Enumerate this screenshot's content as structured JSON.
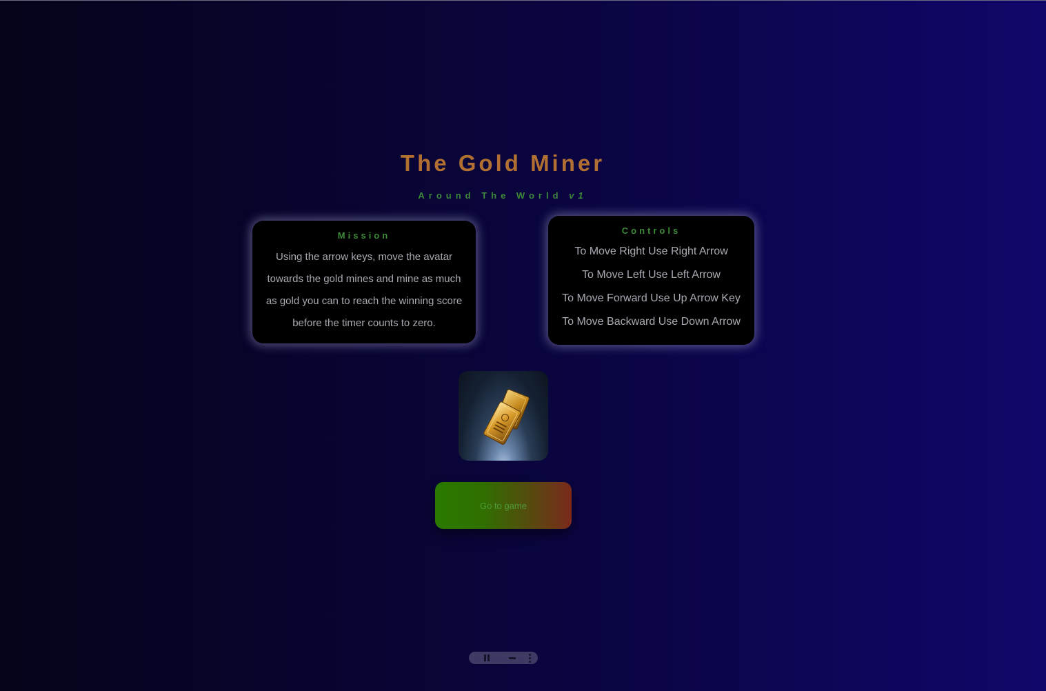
{
  "header": {
    "title": "The Gold Miner",
    "subtitle": "Around The World",
    "version": "v1"
  },
  "mission": {
    "heading": "Mission",
    "text": "Using the arrow keys, move the avatar towards the gold mines and mine as much as gold you can to reach the winning score before the timer counts to zero."
  },
  "controls": {
    "heading": "Controls",
    "items": [
      "To Move Right Use Right Arrow",
      "To Move Left Use Left Arrow",
      "To Move Forward Use Up Arrow Key",
      "To Move Backward Use Down Arrow"
    ]
  },
  "image": {
    "icon": "gold-bars-image"
  },
  "button": {
    "label": "Go to game"
  },
  "media_bar": {
    "icons": [
      "pause-icon",
      "slider-icon",
      "more-options-icon"
    ]
  },
  "colors": {
    "title": "#b26f32",
    "accent_green": "#3e8a3a",
    "card_text": "#a9a9b3",
    "background_left": "#05041a",
    "background_right": "#10066a"
  }
}
